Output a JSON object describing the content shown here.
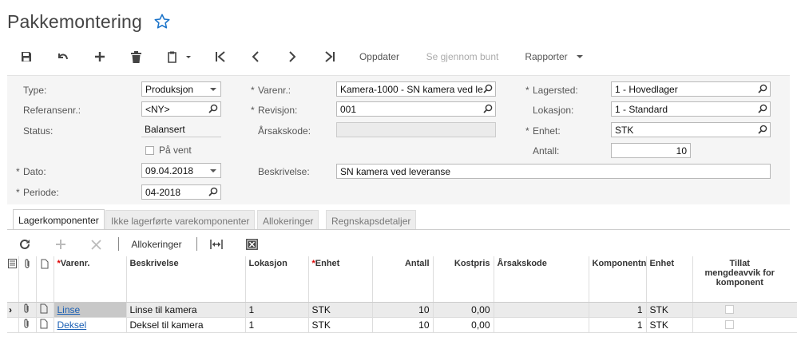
{
  "page": {
    "title": "Pakkemontering",
    "favorite_icon": "star-outline-icon"
  },
  "toolbar": {
    "icons": [
      "save-icon",
      "undo-icon",
      "add-icon",
      "delete-icon",
      "copy-paste-icon",
      "first-icon",
      "prev-icon",
      "next-icon",
      "last-icon"
    ],
    "update_label": "Oppdater",
    "view_batch_label": "Se gjennom bunt",
    "reports_label": "Rapporter"
  },
  "form": {
    "type": {
      "label": "Type:",
      "value": "Produksjon"
    },
    "refnr": {
      "label": "Referansenr.:",
      "value": "<NY>"
    },
    "status": {
      "label": "Status:",
      "value": "Balansert"
    },
    "on_hold": {
      "label": "På vent",
      "checked": false
    },
    "date": {
      "label": "Dato:",
      "value": "09.04.2018"
    },
    "period": {
      "label": "Periode:",
      "value": "04-2018"
    },
    "item": {
      "label": "Varenr.:",
      "value": "Kamera-1000 - SN kamera ved le"
    },
    "revision": {
      "label": "Revisjon:",
      "value": "001"
    },
    "reason": {
      "label": "Årsakskode:",
      "value": ""
    },
    "description": {
      "label": "Beskrivelse:",
      "value": "SN kamera ved leveranse"
    },
    "warehouse": {
      "label": "Lagersted:",
      "value": "1 - Hovedlager"
    },
    "location": {
      "label": "Lokasjon:",
      "value": "1 - Standard"
    },
    "unit": {
      "label": "Enhet:",
      "value": "STK"
    },
    "quantity": {
      "label": "Antall:",
      "value": "10"
    }
  },
  "tabs": [
    "Lagerkomponenter",
    "Ikke lagerførte varekomponenter",
    "Allokeringer",
    "Regnskapsdetaljer"
  ],
  "grid_toolbar": {
    "allocations_label": "Allokeringer"
  },
  "grid": {
    "headers": {
      "item": "Varenr.",
      "description": "Beskrivelse",
      "location": "Lokasjon",
      "unit": "Enhet",
      "qty": "Antall",
      "cost": "Kostpris",
      "reason": "Årsakskode",
      "component": "Komponentnr",
      "unit2": "Enhet",
      "allow": "Tillat mengdeavvik for komponent"
    },
    "rows": [
      {
        "item": "Linse",
        "description": "Linse til kamera",
        "location": "1",
        "unit": "STK",
        "qty": "10",
        "cost": "0,00",
        "reason": "",
        "component": "1",
        "unit2": "STK"
      },
      {
        "item": "Deksel",
        "description": "Deksel til kamera",
        "location": "1",
        "unit": "STK",
        "qty": "10",
        "cost": "0,00",
        "reason": "",
        "component": "1",
        "unit2": "STK"
      }
    ]
  },
  "colors": {
    "link": "#1a5fb4",
    "star": "#1a73c9",
    "required": "#d00"
  }
}
